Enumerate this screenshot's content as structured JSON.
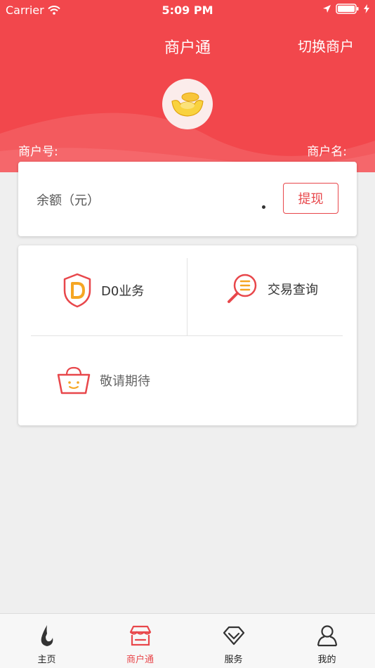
{
  "status_bar": {
    "carrier": "Carrier",
    "time": "5:09 PM"
  },
  "header": {
    "title": "商户通",
    "switch_label": "切换商户",
    "merchant_no_label": "商户号:",
    "merchant_name_label": "商户名:"
  },
  "balance": {
    "label": "余额（元）",
    "withdraw_label": "提现"
  },
  "menu": {
    "items": [
      {
        "label": "D0业务",
        "icon": "shield-d-icon"
      },
      {
        "label": "交易查询",
        "icon": "magnifier-list-icon"
      },
      {
        "label": "敬请期待",
        "icon": "basket-icon"
      }
    ]
  },
  "tabbar": {
    "items": [
      {
        "label": "主页",
        "icon": "home-flame-icon"
      },
      {
        "label": "商户通",
        "icon": "store-icon",
        "active": true
      },
      {
        "label": "服务",
        "icon": "diamond-icon"
      },
      {
        "label": "我的",
        "icon": "user-icon"
      }
    ]
  },
  "colors": {
    "brand": "#f2474c",
    "accent": "#e8474b",
    "icon_orange": "#f5a623"
  }
}
